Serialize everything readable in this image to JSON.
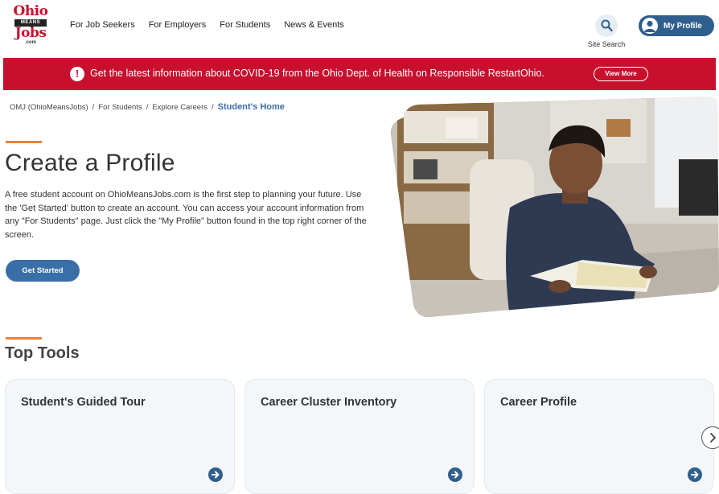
{
  "logo": {
    "line1": "Ohio",
    "line2": "MEANS",
    "line3": "Jobs",
    "line4": ".com"
  },
  "nav": [
    {
      "label": "For Job Seekers"
    },
    {
      "label": "For Employers"
    },
    {
      "label": "For Students"
    },
    {
      "label": "News & Events"
    }
  ],
  "header": {
    "site_search_label": "Site Search",
    "my_profile_label": "My Profile"
  },
  "alert": {
    "text": "Get the latest information about COVID-19 from the Ohio Dept. of Health on Responsible RestartOhio.",
    "button_label": "View More",
    "color": "#c8102e"
  },
  "breadcrumb": {
    "items": [
      "OMJ (OhioMeansJobs)",
      "For Students",
      "Explore Careers"
    ],
    "current": "Student's Home"
  },
  "hero": {
    "title": "Create a Profile",
    "description": "A free student account on OhioMeansJobs.com is the first step to planning your future. Use the 'Get Started' button to create an account. You can access your account information from any \"For Students\" page. Just click the \"My Profile\" button found in the top right corner of the screen.",
    "button_label": "Get Started"
  },
  "top_tools": {
    "title": "Top Tools",
    "cards": [
      {
        "title": "Student's Guided Tour"
      },
      {
        "title": "Career Cluster Inventory"
      },
      {
        "title": "Career Profile"
      }
    ]
  },
  "colors": {
    "accent": "#e8833a",
    "primary": "#3a6ea6",
    "alert": "#c8102e"
  }
}
